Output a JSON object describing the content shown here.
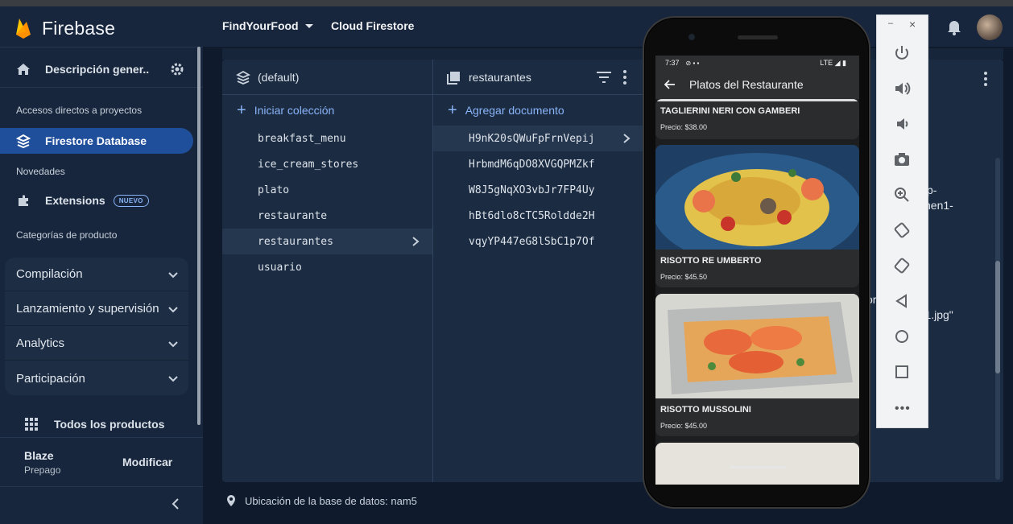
{
  "sidebar": {
    "brand": "Firebase",
    "overview": "Descripción gener...",
    "section_shortcuts": "Accesos directos a proyectos",
    "active_item": "Firestore Database",
    "section_news": "Novedades",
    "extensions": "Extensions",
    "extensions_badge": "NUEVO",
    "section_categories": "Categorías de producto",
    "groups": [
      "Compilación",
      "Lanzamiento y supervisión",
      "Analytics",
      "Participación"
    ],
    "all_products": "Todos los productos",
    "plan_name": "Blaze",
    "plan_type": "Prepago",
    "modify": "Modificar"
  },
  "header": {
    "project": "FindYourFood",
    "breadcrumb": "Cloud Firestore"
  },
  "firestore": {
    "root": "(default)",
    "add_collection": "Iniciar colección",
    "collections": [
      "breakfast_menu",
      "ice_cream_stores",
      "plato",
      "restaurante",
      "restaurantes",
      "usuario"
    ],
    "selected_collection": "restaurantes",
    "add_document": "Agregar documento",
    "documents": [
      "H9nK20sQWuFpFrnVepij",
      "HrbmdM6qDO8XVGQPMZkf",
      "W8J5gNqXO3vbJr7FP4Uy",
      "hBt6dlo8cTC5Roldde2H",
      "vqyYP447eG8lSbC1p7Of"
    ],
    "partial_text_1": "vp-",
    "partial_text_2": "nen1-",
    "partial_text_3": "or",
    "partial_text_4": "1-1.jpg\"",
    "footer_location": "Ubicación de la base de datos: nam5"
  },
  "phone": {
    "time": "7:37",
    "network": "LTE",
    "title": "Platos del Restaurante",
    "dishes": [
      {
        "name": "TAGLIERINI NERI CON GAMBERI",
        "price": "Precio: $38.00"
      },
      {
        "name": "RISOTTO RE UMBERTO",
        "price": "Precio: $45.50"
      },
      {
        "name": "RISOTTO MUSSOLINI",
        "price": "Precio: $45.00"
      }
    ]
  },
  "emulator": {
    "minimize": "–",
    "close": "×",
    "more": "•••"
  }
}
